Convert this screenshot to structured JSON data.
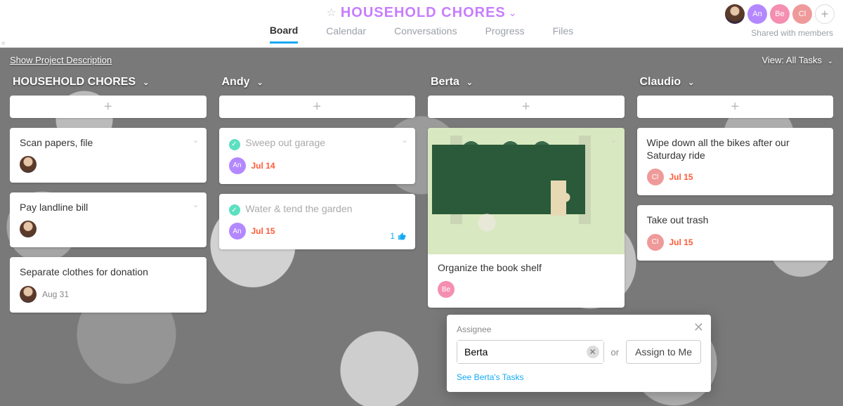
{
  "header": {
    "title": "HOUSEHOLD CHORES",
    "tabs": [
      "Board",
      "Calendar",
      "Conversations",
      "Progress",
      "Files"
    ],
    "active_tab": "Board",
    "shared_label": "Shared with members",
    "members": [
      {
        "kind": "photo",
        "name": "owner"
      },
      {
        "kind": "initials",
        "initials": "An",
        "color": "avatar-an"
      },
      {
        "kind": "initials",
        "initials": "Be",
        "color": "avatar-be"
      },
      {
        "kind": "initials",
        "initials": "Cl",
        "color": "avatar-cl"
      }
    ]
  },
  "board_bar": {
    "show_description": "Show Project Description",
    "view_label": "View: All Tasks"
  },
  "columns": [
    {
      "name": "HOUSEHOLD CHORES",
      "cards": [
        {
          "title": "Scan papers, file",
          "assignee": {
            "kind": "photo"
          }
        },
        {
          "title": "Pay landline bill",
          "assignee": {
            "kind": "photo"
          }
        },
        {
          "title": "Separate clothes for donation",
          "assignee": {
            "kind": "photo"
          },
          "due": "Aug 31",
          "due_style": "grey"
        }
      ]
    },
    {
      "name": "Andy",
      "cards": [
        {
          "title": "Sweep out garage",
          "completed": true,
          "assignee": {
            "kind": "initials",
            "initials": "An",
            "color": "avatar-an"
          },
          "due": "Jul 14",
          "due_style": "red"
        },
        {
          "title": "Water & tend the garden",
          "completed": true,
          "assignee": {
            "kind": "initials",
            "initials": "An",
            "color": "avatar-an"
          },
          "due": "Jul 15",
          "due_style": "red",
          "likes": 1
        }
      ]
    },
    {
      "name": "Berta",
      "cards": [
        {
          "title": "Organize the book shelf",
          "has_image": true,
          "assignee": {
            "kind": "initials",
            "initials": "Be",
            "color": "avatar-be"
          }
        }
      ]
    },
    {
      "name": "Claudio",
      "cards": [
        {
          "title": "Wipe down all the bikes after our Saturday ride",
          "assignee": {
            "kind": "initials",
            "initials": "Cl",
            "color": "avatar-cl"
          },
          "due": "Jul 15",
          "due_style": "red"
        },
        {
          "title": "Take out trash",
          "assignee": {
            "kind": "initials",
            "initials": "Cl",
            "color": "avatar-cl"
          },
          "due": "Jul 15",
          "due_style": "red"
        }
      ]
    }
  ],
  "popover": {
    "label": "Assignee",
    "input_value": "Berta",
    "or": "or",
    "assign_me": "Assign to Me",
    "see_tasks": "See Berta's Tasks"
  }
}
